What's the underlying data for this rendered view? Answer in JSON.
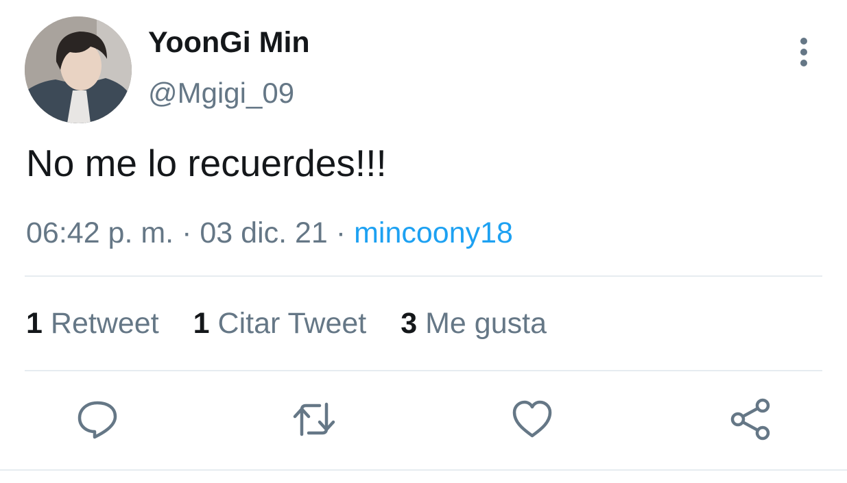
{
  "user": {
    "display_name": "YoonGi Min",
    "handle": "@Mgigi_09"
  },
  "tweet": {
    "text": "No me lo recuerdes!!!",
    "time": "06:42 p. m.",
    "separator": "·",
    "date": "03 dic. 21",
    "source": "mincoony18"
  },
  "stats": {
    "retweets_count": "1",
    "retweets_label": "Retweet",
    "quotes_count": "1",
    "quotes_label": "Citar Tweet",
    "likes_count": "3",
    "likes_label": "Me gusta"
  },
  "actions": {
    "reply_icon": "reply-icon",
    "retweet_icon": "retweet-icon",
    "like_icon": "heart-icon",
    "share_icon": "share-icon"
  },
  "colors": {
    "primary_text": "#14171a",
    "secondary_text": "#657786",
    "link": "#1da1f2",
    "divider": "#e6ecf0"
  }
}
